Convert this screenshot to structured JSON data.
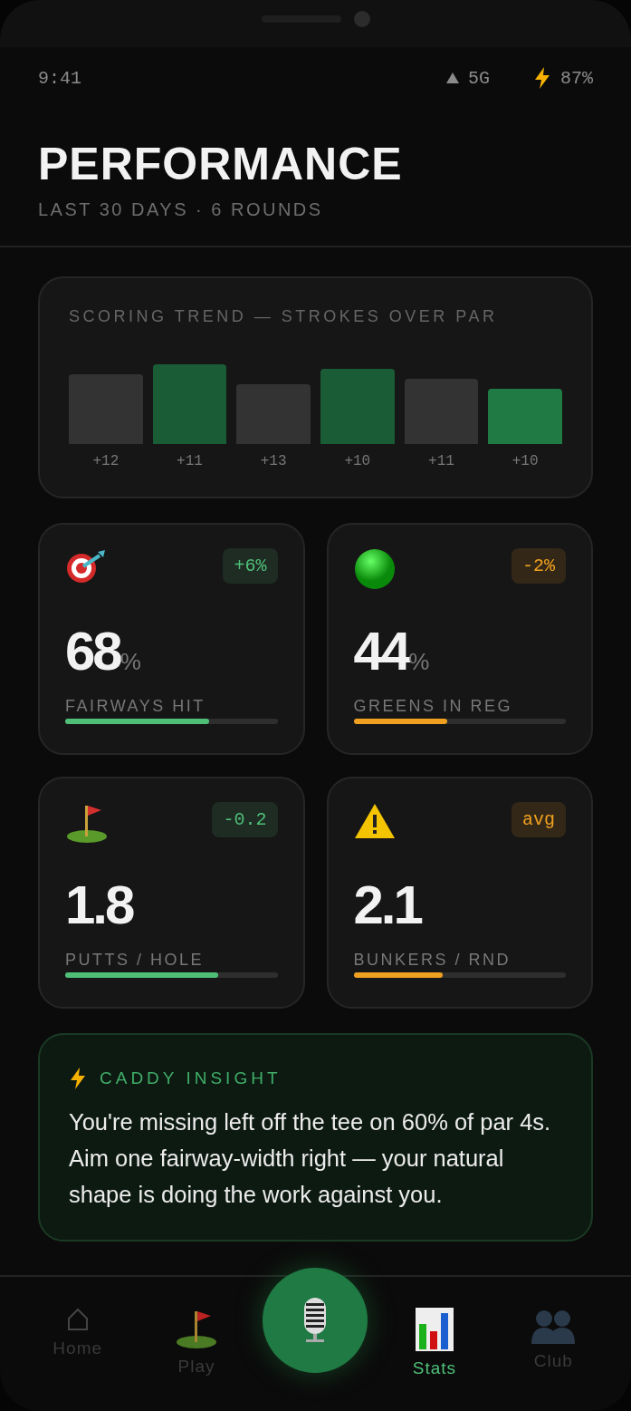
{
  "status_bar": {
    "time": "9:41",
    "network": "5G",
    "battery": "87%"
  },
  "header": {
    "title": "PERFORMANCE",
    "subtitle": "LAST 30 DAYS · 6 ROUNDS"
  },
  "trend": {
    "title": "SCORING TREND — STROKES OVER PAR",
    "bars": [
      {
        "label": "+12",
        "color": "#333333"
      },
      {
        "label": "+11",
        "color": "#1a5c35"
      },
      {
        "label": "+13",
        "color": "#333333"
      },
      {
        "label": "+10",
        "color": "#1a5c35"
      },
      {
        "label": "+11",
        "color": "#333333"
      },
      {
        "label": "+10",
        "color": "#1f7a43"
      }
    ]
  },
  "stats": [
    {
      "delta": "+6%",
      "color": "#4fbf78",
      "value": "68",
      "unit": "%",
      "label": "FAIRWAYS HIT",
      "level": 0.68
    },
    {
      "delta": "-2%",
      "color": "#f0a020",
      "value": "44",
      "unit": "%",
      "label": "GREENS IN REG",
      "level": 0.44
    },
    {
      "delta": "-0.2",
      "color": "#4fbf78",
      "value": "1.8",
      "label": "PUTTS / HOLE",
      "level": 0.72
    },
    {
      "delta": "avg",
      "color": "#f0a020",
      "value": "2.1",
      "label": "BUNKERS / RND",
      "level": 0.42
    }
  ],
  "insight": {
    "title": "CADDY INSIGHT",
    "text": "You're missing left off the tee on 60% of par 4s. Aim one fairway-width right — your natural shape is doing the work against you."
  },
  "nav": [
    {
      "kind": "tab",
      "label": "Home",
      "selected": false
    },
    {
      "kind": "tab",
      "label": "Play",
      "selected": false
    },
    {
      "kind": "center"
    },
    {
      "kind": "tab",
      "label": "Stats",
      "selected": true
    },
    {
      "kind": "tab",
      "label": "Club",
      "selected": false
    }
  ]
}
